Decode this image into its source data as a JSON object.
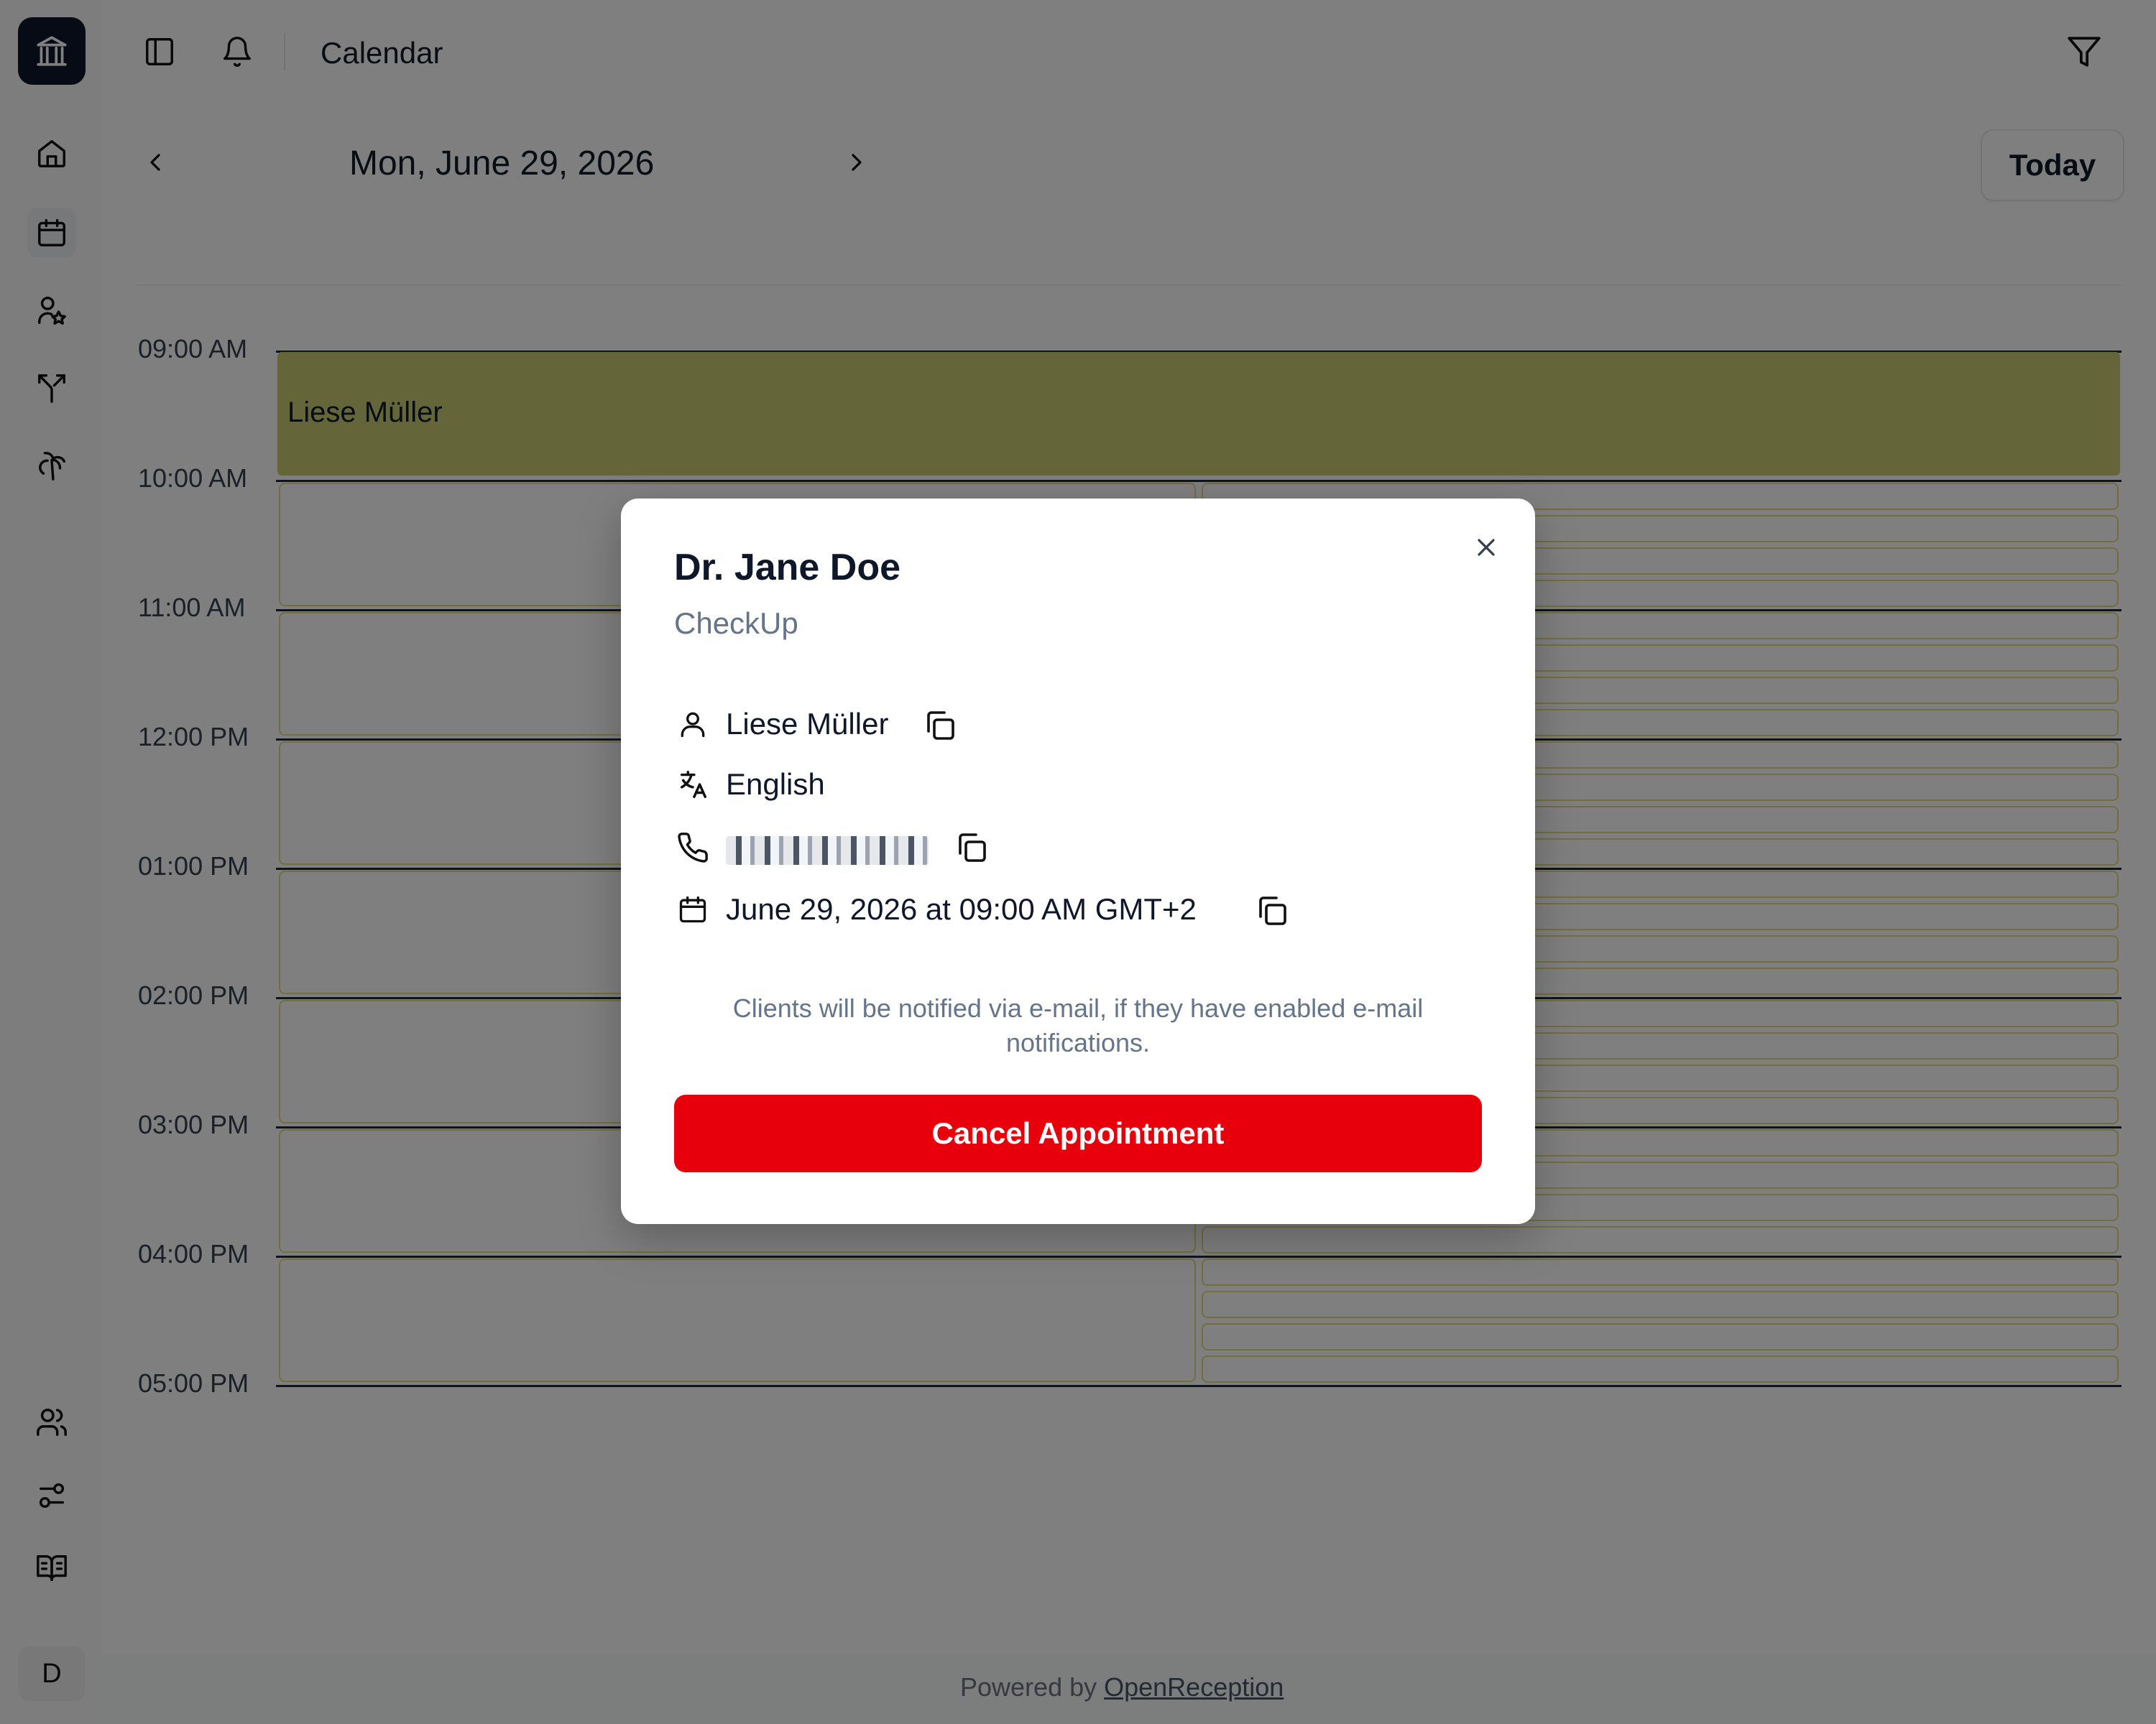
{
  "app": {
    "brand": "bank-icon",
    "accent": "#0f172a"
  },
  "sidebar": {
    "items": [
      {
        "name": "home",
        "icon": "home-icon"
      },
      {
        "name": "calendar",
        "icon": "calendar-icon",
        "active": true
      },
      {
        "name": "clients",
        "icon": "user-star-icon"
      },
      {
        "name": "routes",
        "icon": "split-arrow-icon"
      },
      {
        "name": "vacation",
        "icon": "palm-tree-icon"
      }
    ],
    "bottom_items": [
      {
        "name": "team",
        "icon": "users-icon"
      },
      {
        "name": "settings",
        "icon": "sliders-icon"
      },
      {
        "name": "docs",
        "icon": "book-open-icon"
      }
    ],
    "avatar_initial": "D"
  },
  "topbar": {
    "title": "Calendar"
  },
  "date_nav": {
    "date": "Mon, June 29, 2026",
    "today_label": "Today"
  },
  "calendar": {
    "times": [
      "09:00 AM",
      "10:00 AM",
      "11:00 AM",
      "12:00 PM",
      "01:00 PM",
      "02:00 PM",
      "03:00 PM",
      "04:00 PM",
      "05:00 PM"
    ],
    "event": {
      "label": "Liese Müller",
      "color": "#c9cc75"
    },
    "slot_border_color": "#e6dd7a"
  },
  "footer": {
    "prefix": "Powered by ",
    "link": "OpenReception"
  },
  "modal": {
    "title": "Dr. Jane Doe",
    "subtitle": "CheckUp",
    "client_name": "Liese Müller",
    "language": "English",
    "datetime": "June 29, 2026 at 09:00 AM GMT+2",
    "notice": "Clients will be notified via e-mail, if they have enabled e-mail notifications.",
    "cancel_label": "Cancel Appointment",
    "cancel_color": "#e7000b"
  }
}
